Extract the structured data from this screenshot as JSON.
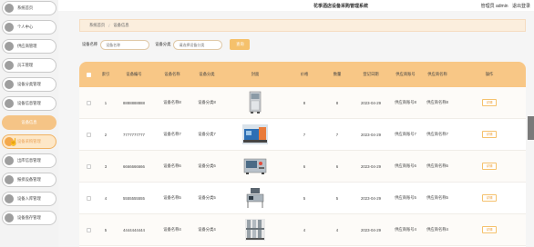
{
  "header": {
    "title": "花季酒店设备采购管理系统",
    "user": "管理员 admin",
    "logout": "退出登录"
  },
  "sidebar": {
    "items": [
      {
        "label": "系统首页",
        "state": "normal"
      },
      {
        "label": "个人中心",
        "state": "normal"
      },
      {
        "label": "供应商管理",
        "state": "normal"
      },
      {
        "label": "员工管理",
        "state": "normal"
      },
      {
        "label": "设备分类管理",
        "state": "normal"
      },
      {
        "label": "设备信息管理",
        "state": "normal"
      },
      {
        "label": "设备信息",
        "state": "expanded"
      },
      {
        "label": "设备采购管理",
        "state": "active"
      },
      {
        "label": "出库信息管理",
        "state": "normal"
      },
      {
        "label": "报损设备管理",
        "state": "normal"
      },
      {
        "label": "设备入库管理",
        "state": "normal"
      },
      {
        "label": "设备盘存管理",
        "state": "normal"
      }
    ]
  },
  "breadcrumb": {
    "home": "系统首页",
    "separator": "/",
    "current": "设备信息"
  },
  "search": {
    "name_label": "设备名称",
    "name_placeholder": "设备名称",
    "category_label": "设备分类",
    "category_placeholder": "请选择设备分类",
    "button": "查询"
  },
  "table": {
    "headers": [
      "索引",
      "设备编号",
      "设备名称",
      "设备分类",
      "封面",
      "价格",
      "数量",
      "登记日期",
      "供应商账号",
      "供应商名称",
      "操作"
    ],
    "rows": [
      {
        "idx": "1",
        "no": "8888888888",
        "name": "设备名称8",
        "category": "设备分类8",
        "image": "cabinet",
        "price": "8",
        "qty": "8",
        "date": "2023-04-29",
        "supplier_acct": "供应商账号8",
        "supplier_name": "供应商名称8",
        "op": "详情"
      },
      {
        "idx": "2",
        "no": "7777777777",
        "name": "设备名称7",
        "category": "设备分类7",
        "image": "machine-blue",
        "price": "7",
        "qty": "7",
        "date": "2023-04-29",
        "supplier_acct": "供应商账号7",
        "supplier_name": "供应商名称7",
        "op": "详情"
      },
      {
        "idx": "3",
        "no": "6666666666",
        "name": "设备名称6",
        "category": "设备分类6",
        "image": "box-device",
        "price": "6",
        "qty": "6",
        "date": "2023-04-29",
        "supplier_acct": "供应商账号6",
        "supplier_name": "供应商名称6",
        "op": "详情"
      },
      {
        "idx": "4",
        "no": "5555555555",
        "name": "设备名称5",
        "category": "设备分类5",
        "image": "rack-unit",
        "price": "5",
        "qty": "5",
        "date": "2023-04-29",
        "supplier_acct": "供应商账号5",
        "supplier_name": "供应商名称5",
        "op": "详情"
      },
      {
        "idx": "5",
        "no": "4444444444",
        "name": "设备名称4",
        "category": "设备分类4",
        "image": "steel-system",
        "price": "4",
        "qty": "4",
        "date": "2023-04-29",
        "supplier_acct": "供应商账号4",
        "supplier_name": "供应商名称4",
        "op": "详情"
      }
    ]
  },
  "colors": {
    "accent": "#f8c786",
    "accent_dark": "#f0a94c",
    "button": "#f5c16c",
    "breadcrumb_bg": "#fbeedd"
  }
}
